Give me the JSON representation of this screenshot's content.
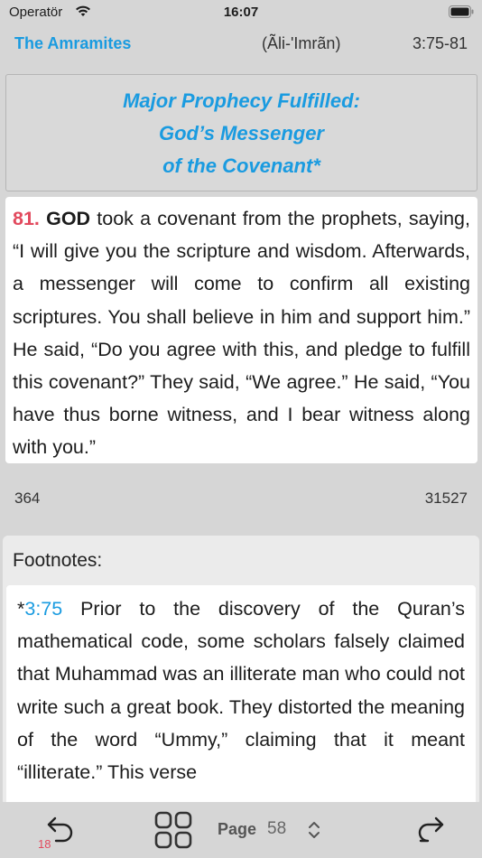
{
  "status": {
    "carrier": "Operatör",
    "time": "16:07"
  },
  "header": {
    "title": "The Amramites",
    "surah": "(Ãli-'Imrãn)",
    "ref": "3:75-81"
  },
  "heading": {
    "line1": "Major Prophecy Fulfilled:",
    "line2": "God’s Messenger",
    "line3": "of the Covenant*"
  },
  "verse": {
    "number": "81.",
    "god": "GOD",
    "text": " took a covenant from the prophets, saying, “I will give you the scripture and wisdom. Afterwards, a messenger will come to confirm all existing scriptures. You shall believe in him and support him.” He said, “Do you agree with this, and pledge to fulfill this covenant?” They said, “We agree.” He said, “You have thus borne wit­ness, and I bear witness along with you.”"
  },
  "page_footer": {
    "left": "364",
    "right": "31527"
  },
  "footnotes": {
    "title": "Footnotes:",
    "star": "*",
    "ref": "3:75",
    "text": " Prior to the discovery of the Quran’s mathematical code, some scholars falsely claimed that Muhammad was an illiterate man who could not write such a great book. They distorted the meaning of the word “Ummy,” claiming that it meant “illiterate.” This verse"
  },
  "toolbar": {
    "back_count": "18",
    "page_label": "Page",
    "page_number": "58"
  },
  "icons": {
    "wifi": "wifi-icon",
    "battery": "battery-icon",
    "back": "undo-arrow-icon",
    "grid": "grid-icon",
    "stepper": "chevron-up-down-icon",
    "forward": "redo-arrow-icon"
  },
  "colors": {
    "accent": "#1a9be0",
    "verse_number": "#e24a5e",
    "background": "#d6d6d6"
  }
}
